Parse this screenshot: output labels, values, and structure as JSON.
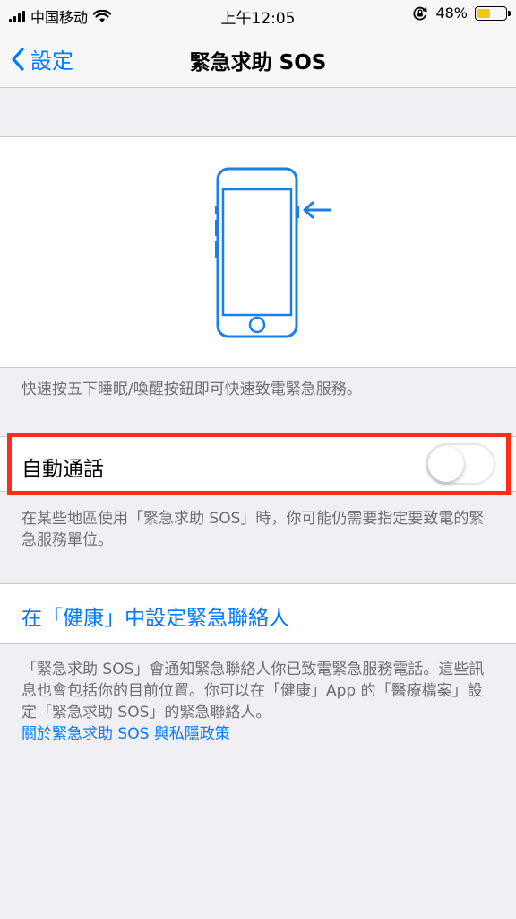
{
  "status_bar": {
    "carrier": "中国移动",
    "time": "上午12:05",
    "battery_percent": "48%",
    "battery_level": 0.48,
    "battery_color": "#f5c518",
    "icons": [
      "signal-icon",
      "wifi-icon",
      "rotation-lock-icon",
      "battery-icon"
    ]
  },
  "nav": {
    "back_label": "設定",
    "title": "緊急求助 SOS"
  },
  "illustration": {
    "icon": "iphone-side-button-icon",
    "color": "#1a7fe8"
  },
  "hint_text": "快速按五下睡眠/喚醒按鈕即可快速致電緊急服務。",
  "auto_call": {
    "label": "自動通話",
    "enabled": false,
    "footer": "在某些地區使用「緊急求助 SOS」時，你可能仍需要指定要致電的緊急服務單位。"
  },
  "health_link": {
    "label": "在「健康」中設定緊急聯絡人",
    "footer": "「緊急求助 SOS」會通知緊急聯絡人你已致電緊急服務電話。這些訊息也會包括你的目前位置。你可以在「健康」App 的「醫療檔案」設定「緊急求助 SOS」的緊急聯絡人。",
    "privacy_link": "關於緊急求助 SOS 與私隱政策"
  },
  "colors": {
    "accent": "#007aff",
    "highlight_border": "#ff2d19"
  }
}
